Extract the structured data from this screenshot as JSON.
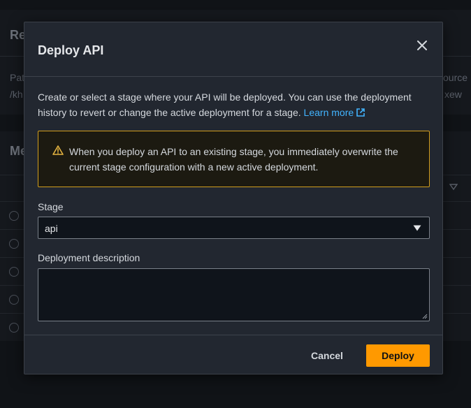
{
  "background": {
    "heading_top": "Re",
    "path_label": "Pat",
    "path_value": "/kh",
    "resource_label": "ource",
    "resource_value": "xew",
    "heading_methods": "Me"
  },
  "modal": {
    "title": "Deploy API",
    "close_icon": "close-icon",
    "intro_text": "Create or select a stage where your API will be deployed. You can use the deployment history to revert or change the active deployment for a stage.",
    "learn_more": "Learn more",
    "warning": {
      "icon": "warning-icon",
      "text": "When you deploy an API to an existing stage, you immediately overwrite the current stage configuration with a new active deployment."
    },
    "stage": {
      "label": "Stage",
      "value": "api"
    },
    "description": {
      "label": "Deployment description",
      "value": ""
    },
    "cancel_label": "Cancel",
    "deploy_label": "Deploy"
  },
  "colors": {
    "accent": "#ff9900",
    "link": "#42b4ff",
    "warning_border": "#d29e1d"
  }
}
